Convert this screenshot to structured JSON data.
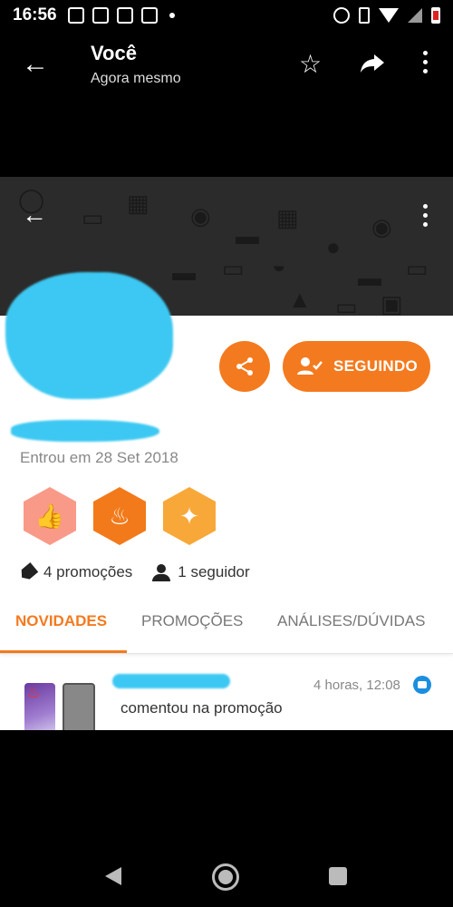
{
  "statusbar": {
    "time": "16:56"
  },
  "header": {
    "title": "Você",
    "subtitle": "Agora mesmo"
  },
  "profile": {
    "joined": "Entrou em 28 Set 2018",
    "follow_button": "SEGUINDO",
    "stats": {
      "promotions": "4 promoções",
      "followers": "1 seguidor"
    }
  },
  "tabs": [
    {
      "label": "NOVIDADES",
      "active": true
    },
    {
      "label": "PROMOÇÕES",
      "active": false
    },
    {
      "label": "ANÁLISES/DÚVIDAS",
      "active": false
    }
  ],
  "feed": {
    "item": {
      "time": "4 horas, 12:08",
      "text": "comentou na promoção"
    }
  },
  "colors": {
    "accent": "#f47a1f",
    "redaction": "#3cc8f2",
    "cover": "#2b2b2b"
  },
  "icons": {
    "header": [
      "back-arrow-icon",
      "star-icon",
      "share-icon",
      "more-vert-icon"
    ],
    "badges": [
      "thumbs-up-icon",
      "flame-icon",
      "torch-icon"
    ],
    "nav": [
      "nav-back-icon",
      "nav-home-icon",
      "nav-recents-icon"
    ]
  }
}
